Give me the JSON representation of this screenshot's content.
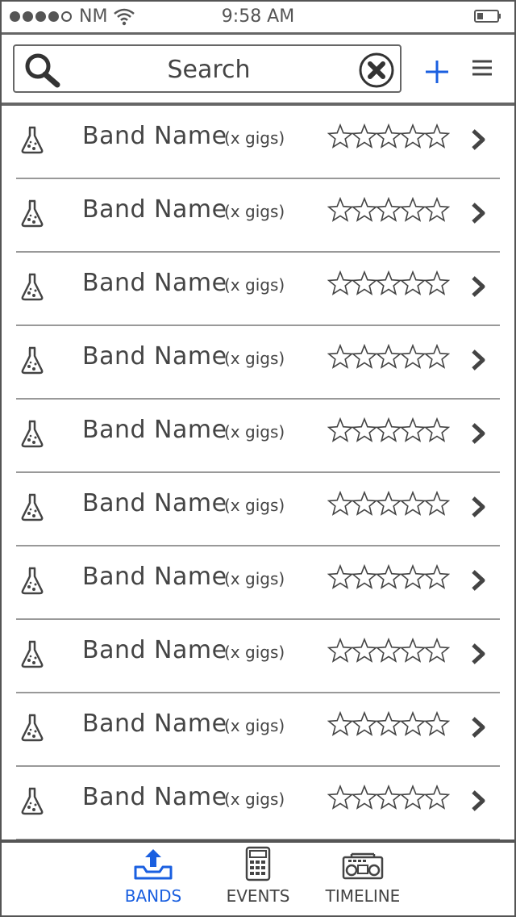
{
  "status_bar": {
    "carrier": "NM",
    "time": "9:58 AM",
    "signal_bars_filled": 4,
    "signal_bars_total": 5
  },
  "search": {
    "placeholder": "Search",
    "icons": {
      "search": "search-icon",
      "clear": "clear-icon",
      "add": "plus-icon",
      "menu": "menu-icon"
    }
  },
  "colors": {
    "accent": "#1a5fe0",
    "ink": "#444444",
    "divider": "#999999"
  },
  "bands": [
    {
      "name": "Band Name",
      "gigs": "(x gigs)",
      "rating": 0
    },
    {
      "name": "Band Name",
      "gigs": "(x gigs)",
      "rating": 0
    },
    {
      "name": "Band Name",
      "gigs": "(x gigs)",
      "rating": 0
    },
    {
      "name": "Band Name",
      "gigs": "(x gigs)",
      "rating": 0
    },
    {
      "name": "Band Name",
      "gigs": "(x gigs)",
      "rating": 0
    },
    {
      "name": "Band Name",
      "gigs": "(x gigs)",
      "rating": 0
    },
    {
      "name": "Band Name",
      "gigs": "(x gigs)",
      "rating": 0
    },
    {
      "name": "Band Name",
      "gigs": "(x gigs)",
      "rating": 0
    },
    {
      "name": "Band Name",
      "gigs": "(x gigs)",
      "rating": 0
    },
    {
      "name": "Band Name",
      "gigs": "(x gigs)",
      "rating": 0
    }
  ],
  "tabs": [
    {
      "label": "BANDS",
      "icon": "upload-tray-icon",
      "active": true
    },
    {
      "label": "EVENTS",
      "icon": "calculator-icon",
      "active": false
    },
    {
      "label": "TIMELINE",
      "icon": "boombox-icon",
      "active": false
    }
  ]
}
